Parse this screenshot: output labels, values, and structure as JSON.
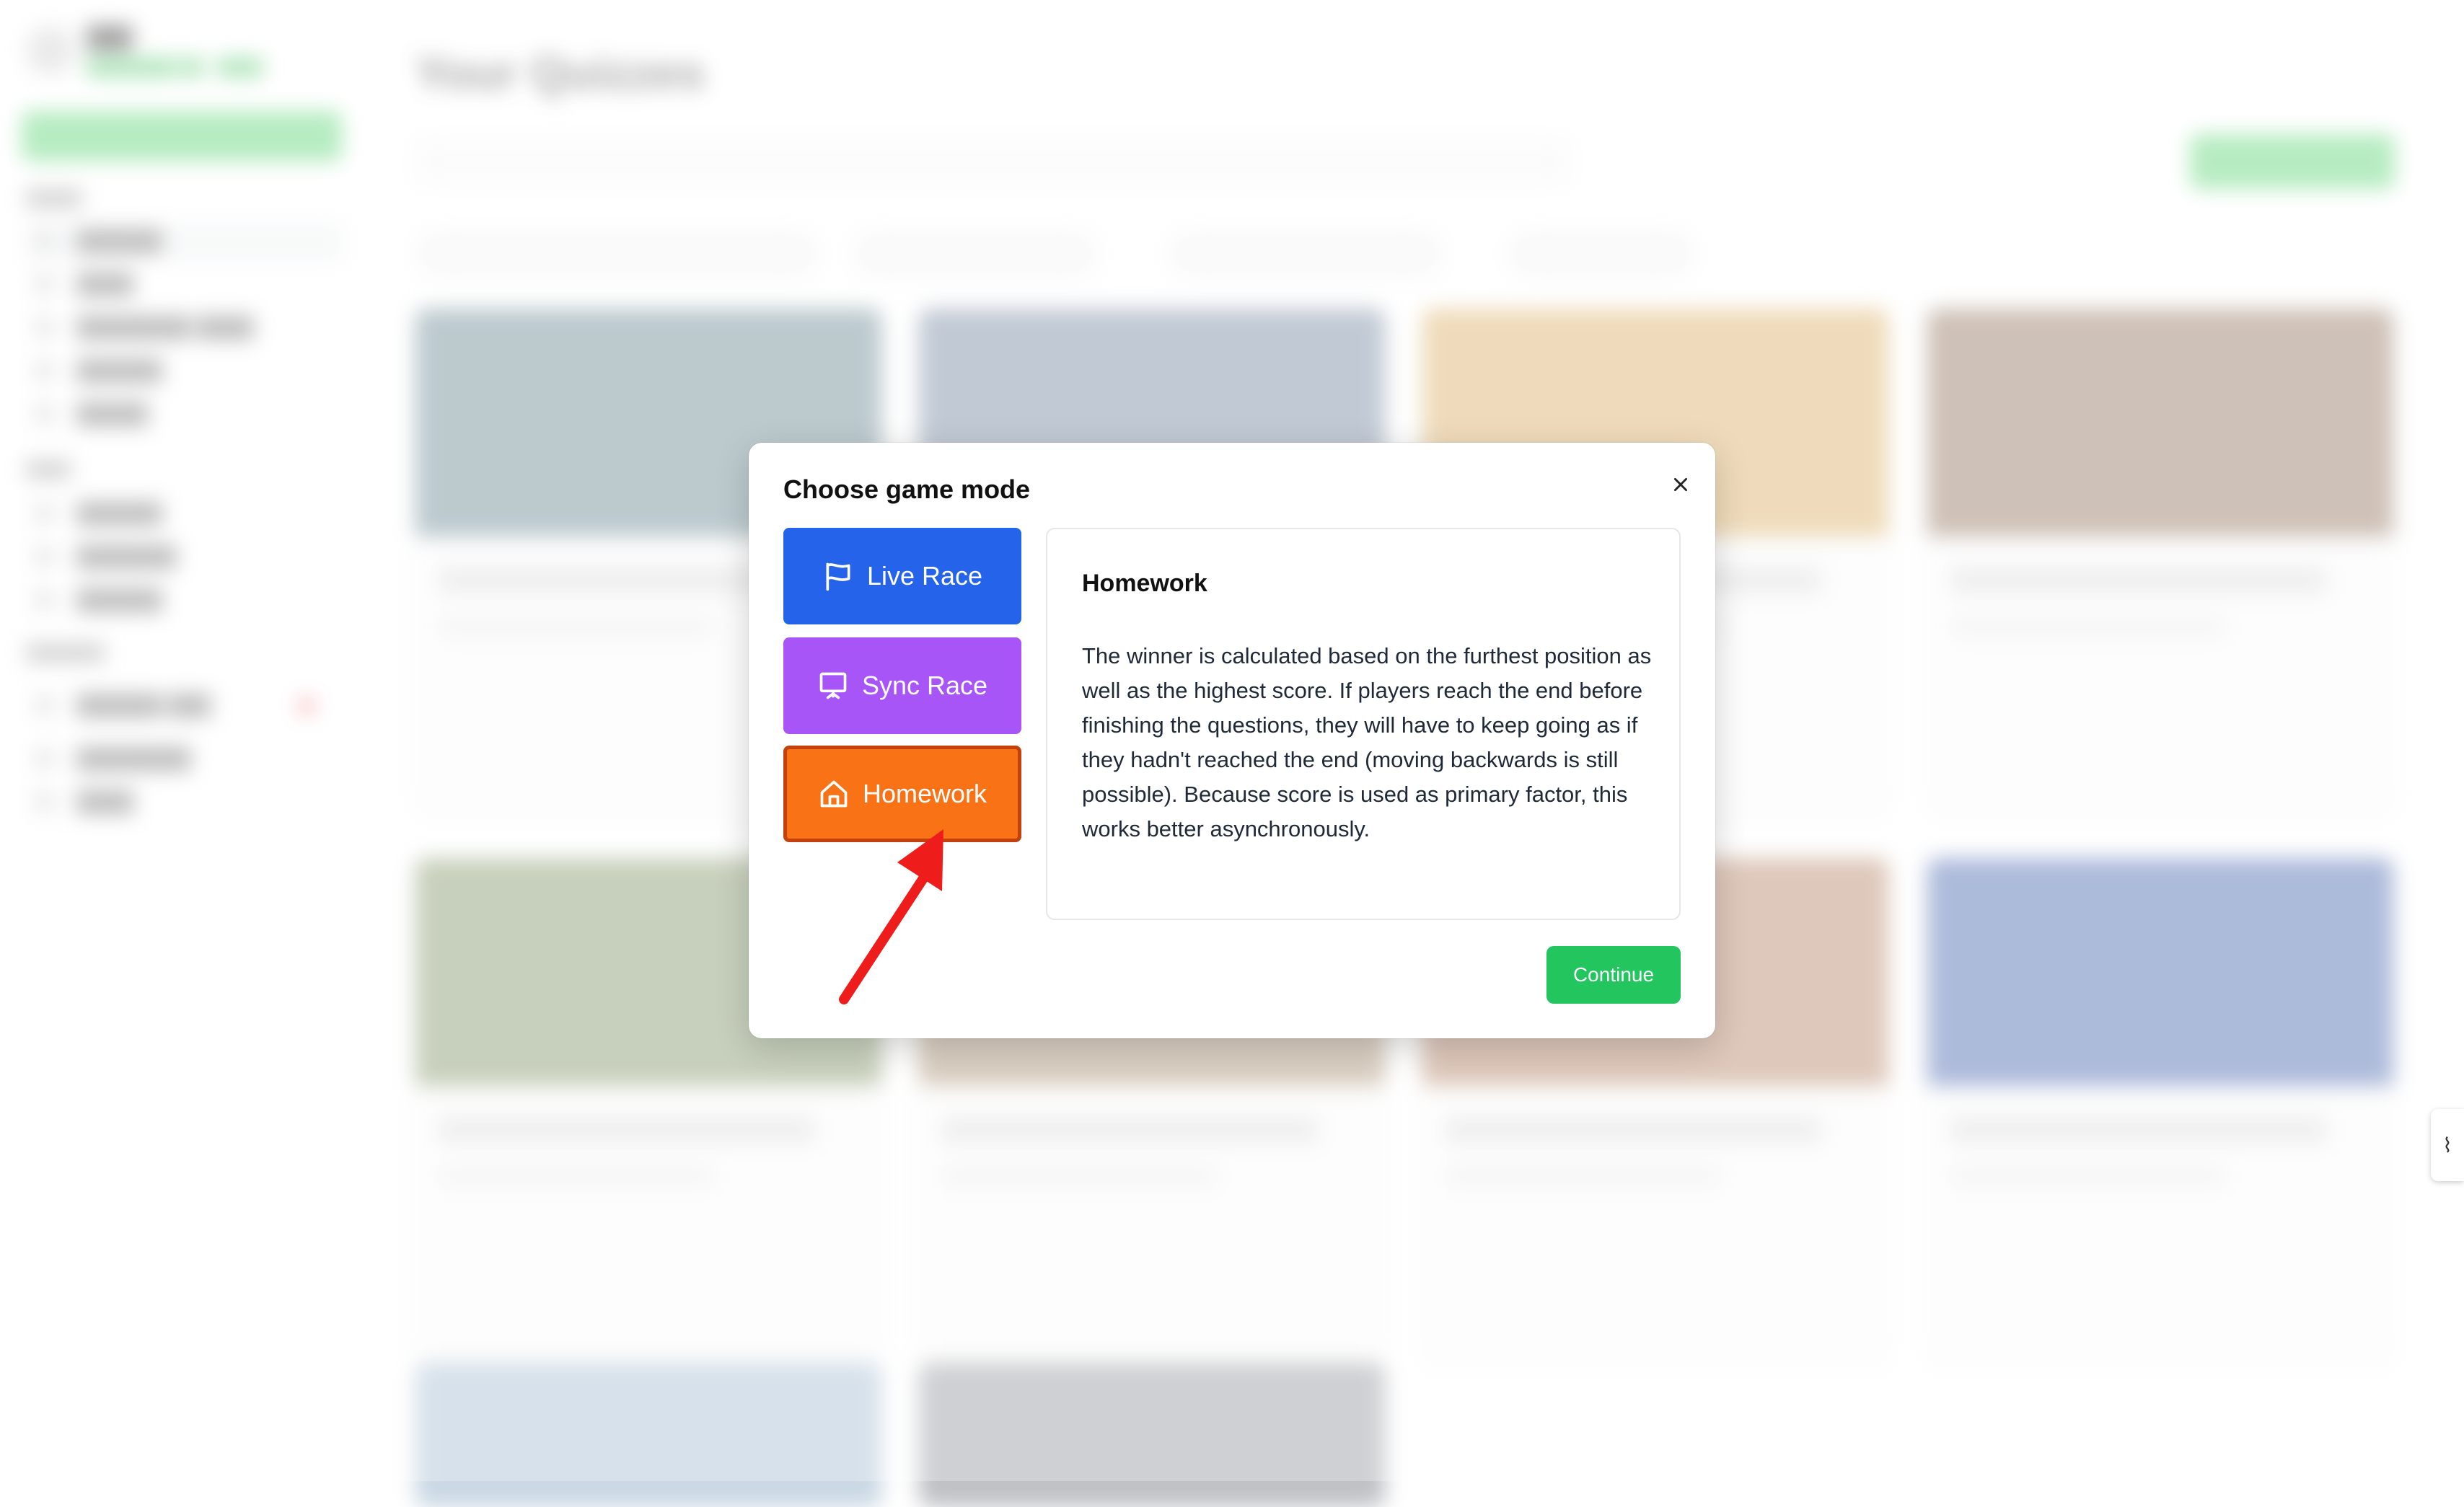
{
  "modal": {
    "title": "Choose game mode",
    "modes": [
      {
        "label": "Live Race",
        "icon": "flag-icon",
        "color": "#2563eb"
      },
      {
        "label": "Sync Race",
        "icon": "presentation-icon",
        "color": "#a855f7"
      },
      {
        "label": "Homework",
        "icon": "home-icon",
        "color": "#f97316",
        "selected": true
      }
    ],
    "description": {
      "title": "Homework",
      "text": "The winner is calculated based on the furthest position as well as the highest score. If players reach the end before finishing the questions, they will have to keep going as if they hadn't reached the end (moving backwards is still possible). Because score is used as primary factor, this works better asynchronously."
    },
    "continue_label": "Continue"
  },
  "page": {
    "title": "Your Quizzes"
  },
  "annotation": {
    "arrow_color": "#ef1c1c"
  }
}
